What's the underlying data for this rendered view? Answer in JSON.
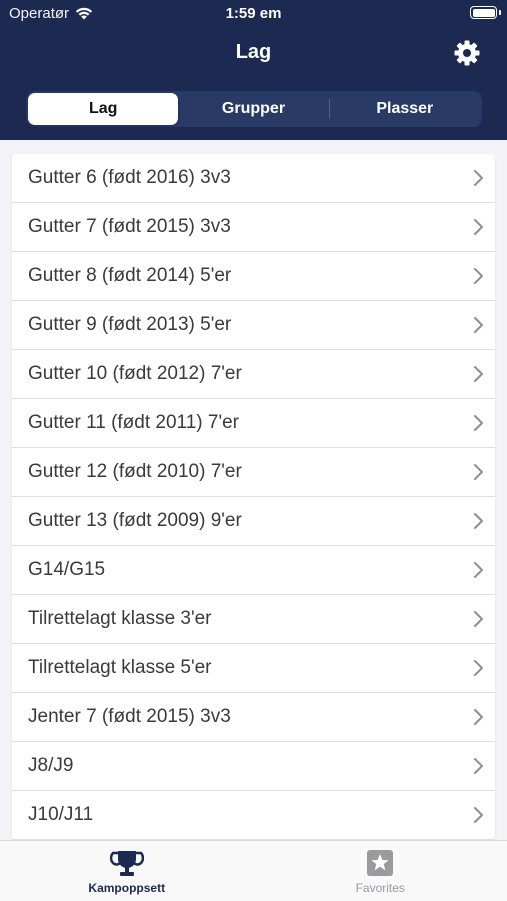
{
  "status_bar": {
    "carrier": "Operatør",
    "time": "1:59 em"
  },
  "nav": {
    "title": "Lag"
  },
  "segments": [
    {
      "label": "Lag",
      "active": true
    },
    {
      "label": "Grupper",
      "active": false
    },
    {
      "label": "Plasser",
      "active": false
    }
  ],
  "list": {
    "items": [
      "Gutter 6 (født 2016) 3v3",
      "Gutter 7 (født 2015) 3v3",
      "Gutter 8 (født 2014) 5'er",
      "Gutter 9 (født 2013) 5'er",
      "Gutter 10 (født 2012) 7'er",
      "Gutter 11 (født 2011) 7'er",
      "Gutter 12 (født 2010) 7'er",
      "Gutter 13 (født 2009) 9'er",
      "G14/G15",
      "Tilrettelagt klasse 3'er",
      "Tilrettelagt klasse 5'er",
      "Jenter 7 (født 2015) 3v3",
      "J8/J9",
      "J10/J11"
    ]
  },
  "tabbar": {
    "tabs": [
      {
        "label": "Kampoppsett",
        "icon": "trophy-icon",
        "active": true
      },
      {
        "label": "Favorites",
        "icon": "star-icon",
        "active": false
      }
    ]
  },
  "colors": {
    "header": "#1c2a52",
    "accent": "#1c2a52",
    "inactive_tab": "#9a9a9f"
  }
}
